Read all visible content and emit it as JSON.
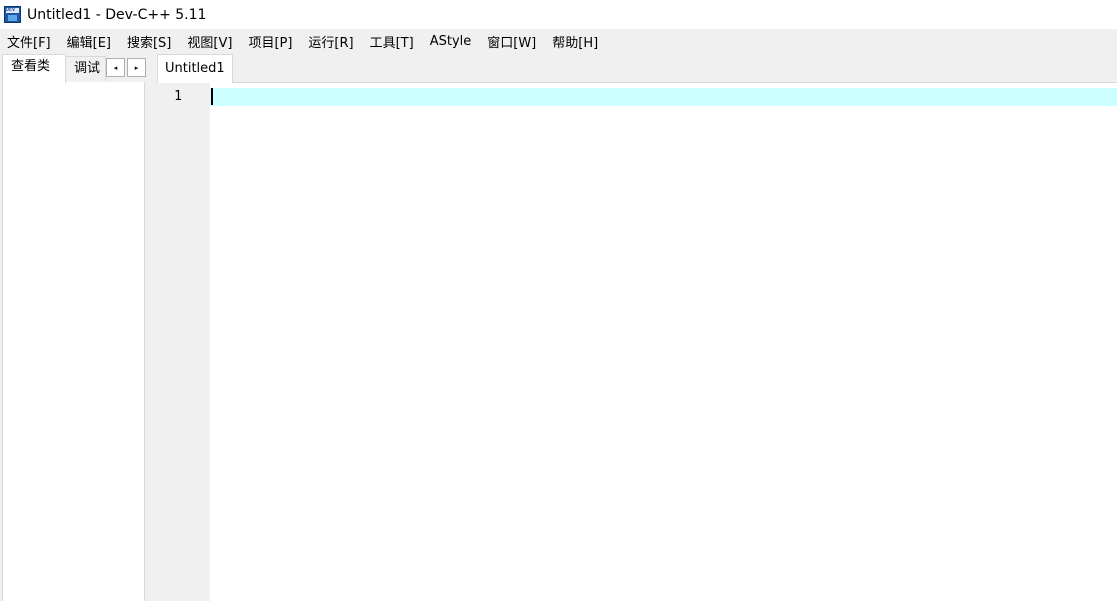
{
  "window": {
    "title": "Untitled1 - Dev-C++ 5.11",
    "icon": "dev-cpp-app-icon",
    "icon_label": "DEV"
  },
  "menu": {
    "items": [
      {
        "label": "文件[F]"
      },
      {
        "label": "编辑[E]"
      },
      {
        "label": "搜索[S]"
      },
      {
        "label": "视图[V]"
      },
      {
        "label": "项目[P]"
      },
      {
        "label": "运行[R]"
      },
      {
        "label": "工具[T]"
      },
      {
        "label": "AStyle"
      },
      {
        "label": "窗口[W]"
      },
      {
        "label": "帮助[H]"
      }
    ]
  },
  "left_panel": {
    "tabs": [
      {
        "label": "查看类",
        "active": true
      },
      {
        "label": "调试",
        "active": false
      }
    ],
    "scroll_left": "◂",
    "scroll_right": "▸"
  },
  "editor": {
    "tabs": [
      {
        "label": "Untitled1",
        "active": true
      }
    ],
    "lines": [
      {
        "number": "1",
        "text": ""
      }
    ],
    "current_line_color": "#ccffff",
    "gutter_color": "#f0f0f0"
  }
}
